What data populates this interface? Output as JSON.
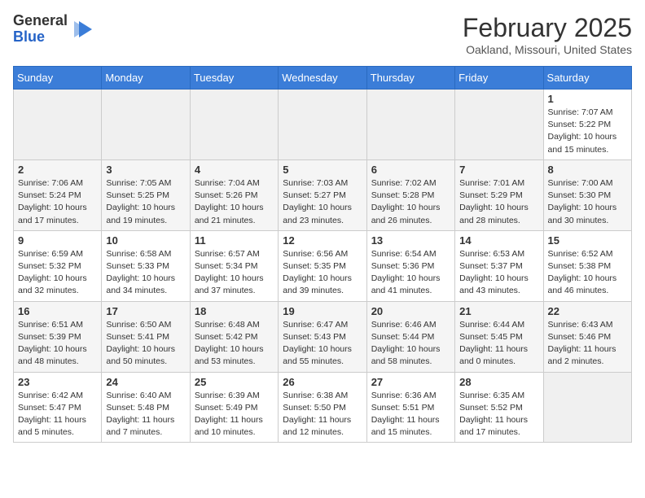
{
  "header": {
    "logo_general": "General",
    "logo_blue": "Blue",
    "month_title": "February 2025",
    "location": "Oakland, Missouri, United States"
  },
  "calendar": {
    "days_of_week": [
      "Sunday",
      "Monday",
      "Tuesday",
      "Wednesday",
      "Thursday",
      "Friday",
      "Saturday"
    ],
    "weeks": [
      [
        {
          "day": "",
          "sunrise": "",
          "sunset": "",
          "daylight": "",
          "empty": true
        },
        {
          "day": "",
          "sunrise": "",
          "sunset": "",
          "daylight": "",
          "empty": true
        },
        {
          "day": "",
          "sunrise": "",
          "sunset": "",
          "daylight": "",
          "empty": true
        },
        {
          "day": "",
          "sunrise": "",
          "sunset": "",
          "daylight": "",
          "empty": true
        },
        {
          "day": "",
          "sunrise": "",
          "sunset": "",
          "daylight": "",
          "empty": true
        },
        {
          "day": "",
          "sunrise": "",
          "sunset": "",
          "daylight": "",
          "empty": true
        },
        {
          "day": "1",
          "sunrise": "Sunrise: 7:07 AM",
          "sunset": "Sunset: 5:22 PM",
          "daylight": "Daylight: 10 hours and 15 minutes.",
          "empty": false
        }
      ],
      [
        {
          "day": "2",
          "sunrise": "Sunrise: 7:06 AM",
          "sunset": "Sunset: 5:24 PM",
          "daylight": "Daylight: 10 hours and 17 minutes.",
          "empty": false
        },
        {
          "day": "3",
          "sunrise": "Sunrise: 7:05 AM",
          "sunset": "Sunset: 5:25 PM",
          "daylight": "Daylight: 10 hours and 19 minutes.",
          "empty": false
        },
        {
          "day": "4",
          "sunrise": "Sunrise: 7:04 AM",
          "sunset": "Sunset: 5:26 PM",
          "daylight": "Daylight: 10 hours and 21 minutes.",
          "empty": false
        },
        {
          "day": "5",
          "sunrise": "Sunrise: 7:03 AM",
          "sunset": "Sunset: 5:27 PM",
          "daylight": "Daylight: 10 hours and 23 minutes.",
          "empty": false
        },
        {
          "day": "6",
          "sunrise": "Sunrise: 7:02 AM",
          "sunset": "Sunset: 5:28 PM",
          "daylight": "Daylight: 10 hours and 26 minutes.",
          "empty": false
        },
        {
          "day": "7",
          "sunrise": "Sunrise: 7:01 AM",
          "sunset": "Sunset: 5:29 PM",
          "daylight": "Daylight: 10 hours and 28 minutes.",
          "empty": false
        },
        {
          "day": "8",
          "sunrise": "Sunrise: 7:00 AM",
          "sunset": "Sunset: 5:30 PM",
          "daylight": "Daylight: 10 hours and 30 minutes.",
          "empty": false
        }
      ],
      [
        {
          "day": "9",
          "sunrise": "Sunrise: 6:59 AM",
          "sunset": "Sunset: 5:32 PM",
          "daylight": "Daylight: 10 hours and 32 minutes.",
          "empty": false
        },
        {
          "day": "10",
          "sunrise": "Sunrise: 6:58 AM",
          "sunset": "Sunset: 5:33 PM",
          "daylight": "Daylight: 10 hours and 34 minutes.",
          "empty": false
        },
        {
          "day": "11",
          "sunrise": "Sunrise: 6:57 AM",
          "sunset": "Sunset: 5:34 PM",
          "daylight": "Daylight: 10 hours and 37 minutes.",
          "empty": false
        },
        {
          "day": "12",
          "sunrise": "Sunrise: 6:56 AM",
          "sunset": "Sunset: 5:35 PM",
          "daylight": "Daylight: 10 hours and 39 minutes.",
          "empty": false
        },
        {
          "day": "13",
          "sunrise": "Sunrise: 6:54 AM",
          "sunset": "Sunset: 5:36 PM",
          "daylight": "Daylight: 10 hours and 41 minutes.",
          "empty": false
        },
        {
          "day": "14",
          "sunrise": "Sunrise: 6:53 AM",
          "sunset": "Sunset: 5:37 PM",
          "daylight": "Daylight: 10 hours and 43 minutes.",
          "empty": false
        },
        {
          "day": "15",
          "sunrise": "Sunrise: 6:52 AM",
          "sunset": "Sunset: 5:38 PM",
          "daylight": "Daylight: 10 hours and 46 minutes.",
          "empty": false
        }
      ],
      [
        {
          "day": "16",
          "sunrise": "Sunrise: 6:51 AM",
          "sunset": "Sunset: 5:39 PM",
          "daylight": "Daylight: 10 hours and 48 minutes.",
          "empty": false
        },
        {
          "day": "17",
          "sunrise": "Sunrise: 6:50 AM",
          "sunset": "Sunset: 5:41 PM",
          "daylight": "Daylight: 10 hours and 50 minutes.",
          "empty": false
        },
        {
          "day": "18",
          "sunrise": "Sunrise: 6:48 AM",
          "sunset": "Sunset: 5:42 PM",
          "daylight": "Daylight: 10 hours and 53 minutes.",
          "empty": false
        },
        {
          "day": "19",
          "sunrise": "Sunrise: 6:47 AM",
          "sunset": "Sunset: 5:43 PM",
          "daylight": "Daylight: 10 hours and 55 minutes.",
          "empty": false
        },
        {
          "day": "20",
          "sunrise": "Sunrise: 6:46 AM",
          "sunset": "Sunset: 5:44 PM",
          "daylight": "Daylight: 10 hours and 58 minutes.",
          "empty": false
        },
        {
          "day": "21",
          "sunrise": "Sunrise: 6:44 AM",
          "sunset": "Sunset: 5:45 PM",
          "daylight": "Daylight: 11 hours and 0 minutes.",
          "empty": false
        },
        {
          "day": "22",
          "sunrise": "Sunrise: 6:43 AM",
          "sunset": "Sunset: 5:46 PM",
          "daylight": "Daylight: 11 hours and 2 minutes.",
          "empty": false
        }
      ],
      [
        {
          "day": "23",
          "sunrise": "Sunrise: 6:42 AM",
          "sunset": "Sunset: 5:47 PM",
          "daylight": "Daylight: 11 hours and 5 minutes.",
          "empty": false
        },
        {
          "day": "24",
          "sunrise": "Sunrise: 6:40 AM",
          "sunset": "Sunset: 5:48 PM",
          "daylight": "Daylight: 11 hours and 7 minutes.",
          "empty": false
        },
        {
          "day": "25",
          "sunrise": "Sunrise: 6:39 AM",
          "sunset": "Sunset: 5:49 PM",
          "daylight": "Daylight: 11 hours and 10 minutes.",
          "empty": false
        },
        {
          "day": "26",
          "sunrise": "Sunrise: 6:38 AM",
          "sunset": "Sunset: 5:50 PM",
          "daylight": "Daylight: 11 hours and 12 minutes.",
          "empty": false
        },
        {
          "day": "27",
          "sunrise": "Sunrise: 6:36 AM",
          "sunset": "Sunset: 5:51 PM",
          "daylight": "Daylight: 11 hours and 15 minutes.",
          "empty": false
        },
        {
          "day": "28",
          "sunrise": "Sunrise: 6:35 AM",
          "sunset": "Sunset: 5:52 PM",
          "daylight": "Daylight: 11 hours and 17 minutes.",
          "empty": false
        },
        {
          "day": "",
          "sunrise": "",
          "sunset": "",
          "daylight": "",
          "empty": true
        }
      ]
    ]
  }
}
